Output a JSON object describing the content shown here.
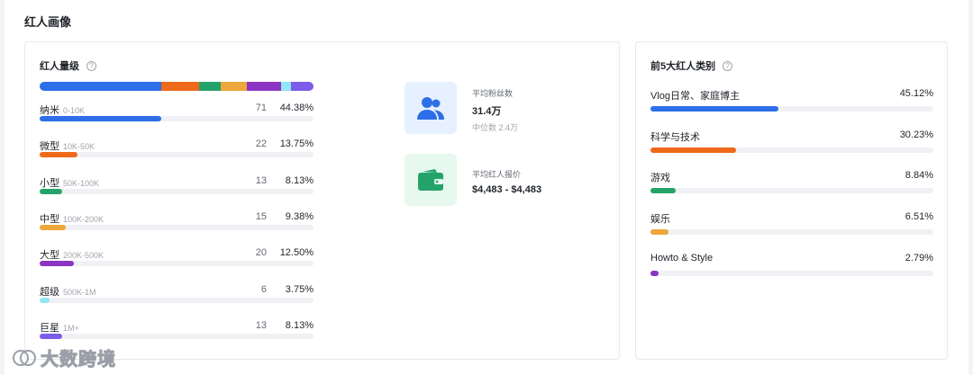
{
  "page": {
    "title": "红人画像"
  },
  "level_card": {
    "title": "红人量级",
    "tiers": [
      {
        "name": "纳米",
        "range": "0-10K",
        "count": "71",
        "pct": "44.38%",
        "share": 0.4438,
        "color": "#2c6fe8"
      },
      {
        "name": "微型",
        "range": "10K-50K",
        "count": "22",
        "pct": "13.75%",
        "share": 0.1375,
        "color": "#ee6a1a"
      },
      {
        "name": "小型",
        "range": "50K-100K",
        "count": "13",
        "pct": "8.13%",
        "share": 0.0813,
        "color": "#23a36a"
      },
      {
        "name": "中型",
        "range": "100K-200K",
        "count": "15",
        "pct": "9.38%",
        "share": 0.0938,
        "color": "#eda73a"
      },
      {
        "name": "大型",
        "range": "200K-500K",
        "count": "20",
        "pct": "12.50%",
        "share": 0.125,
        "color": "#8b35c2"
      },
      {
        "name": "超级",
        "range": "500K-1M",
        "count": "6",
        "pct": "3.75%",
        "share": 0.0375,
        "color": "#8fe6f4"
      },
      {
        "name": "巨星",
        "range": "1M+",
        "count": "13",
        "pct": "8.13%",
        "share": 0.0813,
        "color": "#7c5ce8"
      }
    ],
    "stats": {
      "fans_label": "平均粉丝数",
      "fans_value": "31.4万",
      "fans_median": "中位数 2.4万",
      "price_label": "平均红人报价",
      "price_value": "$4,483 - $4,483"
    }
  },
  "category_card": {
    "title": "前5大红人类别",
    "items": [
      {
        "name": "Vlog日常、家庭博主",
        "pct": "45.12%",
        "share": 0.4512,
        "color": "#2c6fe8"
      },
      {
        "name": "科学与技术",
        "pct": "30.23%",
        "share": 0.3023,
        "color": "#ee6a1a"
      },
      {
        "name": "游戏",
        "pct": "8.84%",
        "share": 0.0884,
        "color": "#23a36a"
      },
      {
        "name": "娱乐",
        "pct": "6.51%",
        "share": 0.0651,
        "color": "#eda73a"
      },
      {
        "name": "Howto & Style",
        "pct": "2.79%",
        "share": 0.0279,
        "color": "#8b35c2"
      }
    ]
  },
  "icons": {
    "help": "question-circle-icon",
    "fans": "users-icon",
    "price": "wallet-icon"
  },
  "watermark": {
    "text": "大数跨境"
  }
}
